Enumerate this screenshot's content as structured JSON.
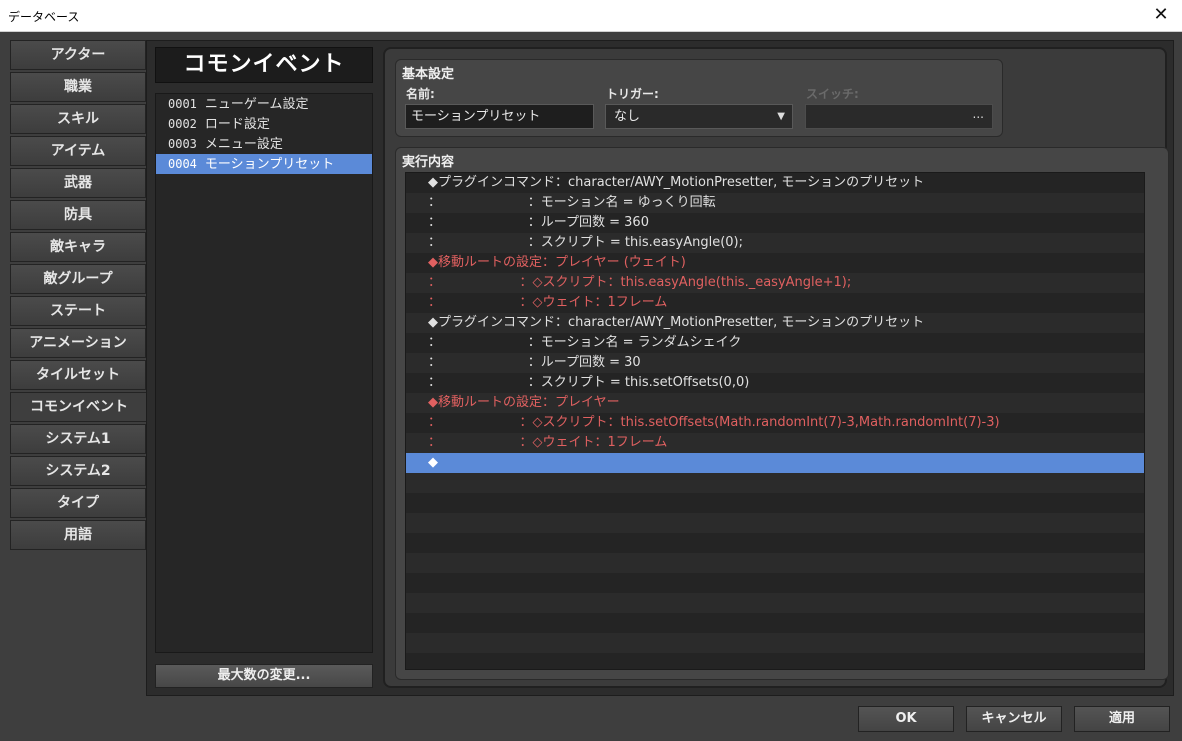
{
  "window": {
    "title": "データベース",
    "close_glyph": "✕"
  },
  "categories": [
    {
      "label": "アクター"
    },
    {
      "label": "職業"
    },
    {
      "label": "スキル"
    },
    {
      "label": "アイテム"
    },
    {
      "label": "武器"
    },
    {
      "label": "防具"
    },
    {
      "label": "敵キャラ"
    },
    {
      "label": "敵グループ"
    },
    {
      "label": "ステート"
    },
    {
      "label": "アニメーション"
    },
    {
      "label": "タイルセット"
    },
    {
      "label": "コモンイベント"
    },
    {
      "label": "システム1"
    },
    {
      "label": "システム2"
    },
    {
      "label": "タイプ"
    },
    {
      "label": "用語"
    }
  ],
  "active_category": "コモンイベント",
  "event_list": {
    "title": "コモンイベント",
    "items": [
      {
        "id": "0001",
        "name": "ニューゲーム設定"
      },
      {
        "id": "0002",
        "name": "ロード設定"
      },
      {
        "id": "0003",
        "name": "メニュー設定"
      },
      {
        "id": "0004",
        "name": "モーションプリセット"
      }
    ],
    "selected_id": "0004",
    "max_button": "最大数の変更..."
  },
  "basic": {
    "section_title": "基本設定",
    "name_label": "名前:",
    "name_value": "モーションプリセット",
    "trigger_label": "トリガー:",
    "trigger_value": "なし",
    "switch_label": "スイッチ:",
    "switch_button": "..."
  },
  "execution": {
    "section_title": "実行内容",
    "rows": [
      {
        "text": "◆プラグインコマンド：character/AWY_MotionPresetter, モーションのプリセット",
        "style": "normal"
      },
      {
        "text": "：                     ：モーション名 = ゆっくり回転",
        "style": "normal"
      },
      {
        "text": "：                     ：ループ回数 = 360",
        "style": "normal"
      },
      {
        "text": "：                     ：スクリプト = this.easyAngle(0);",
        "style": "normal"
      },
      {
        "text": "◆移動ルートの設定：プレイヤー (ウェイト)",
        "style": "red"
      },
      {
        "text": "：                   ：◇スクリプト：this.easyAngle(this._easyAngle+1);",
        "style": "red"
      },
      {
        "text": "：                   ：◇ウェイト：1フレーム",
        "style": "red"
      },
      {
        "text": "◆プラグインコマンド：character/AWY_MotionPresetter, モーションのプリセット",
        "style": "normal"
      },
      {
        "text": "：                     ：モーション名 = ランダムシェイク",
        "style": "normal"
      },
      {
        "text": "：                     ：ループ回数 = 30",
        "style": "normal"
      },
      {
        "text": "：                     ：スクリプト = this.setOffsets(0,0)",
        "style": "normal"
      },
      {
        "text": "◆移動ルートの設定：プレイヤー",
        "style": "red"
      },
      {
        "text": "：                   ：◇スクリプト：this.setOffsets(Math.randomInt(7)-3,Math.randomInt(7)-3)",
        "style": "red"
      },
      {
        "text": "：                   ：◇ウェイト：1フレーム",
        "style": "red"
      },
      {
        "text": "◆",
        "style": "selected"
      }
    ]
  },
  "buttons": {
    "ok": "OK",
    "cancel": "キャンセル",
    "apply": "適用"
  }
}
